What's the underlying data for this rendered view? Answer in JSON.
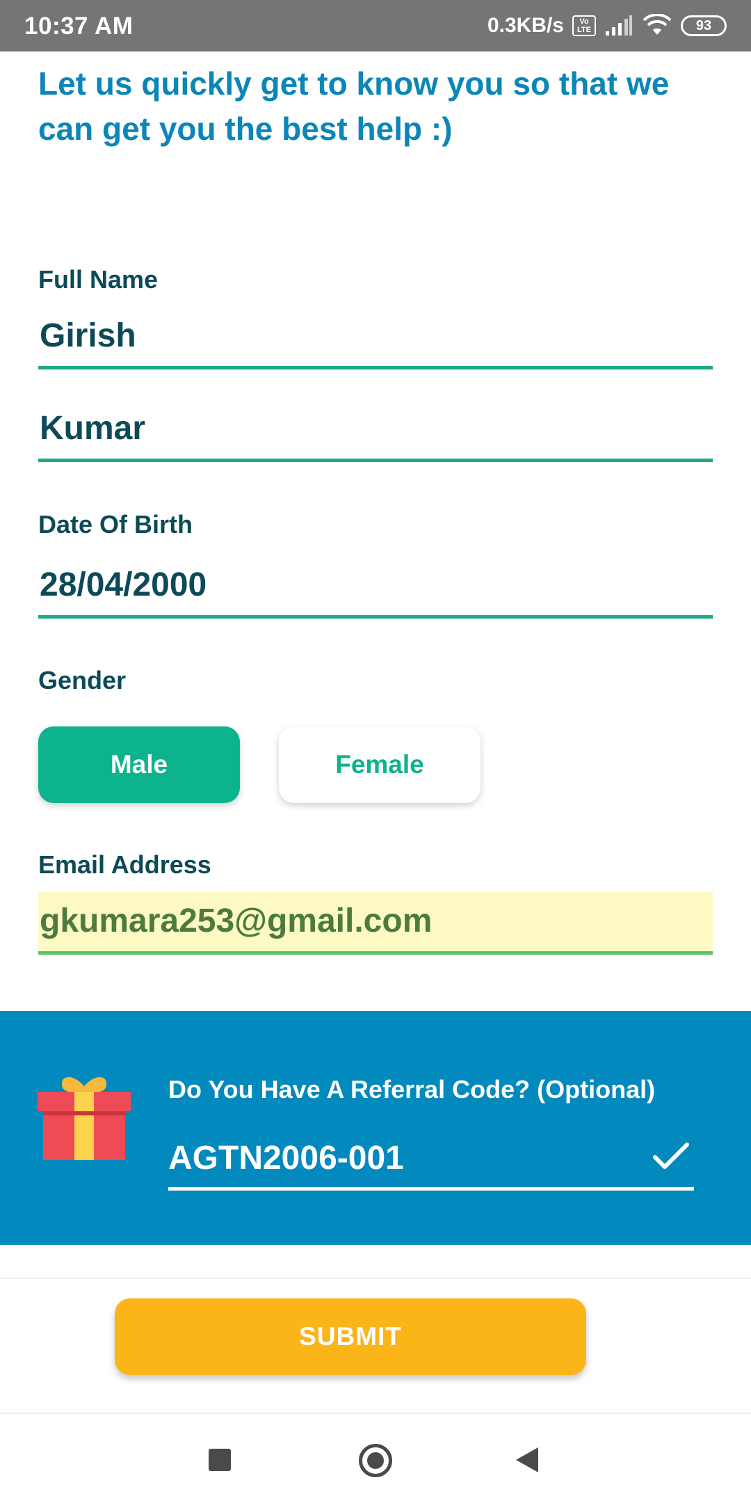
{
  "status_bar": {
    "time": "10:37 AM",
    "net_speed": "0.3KB/s",
    "volte_top": "Vo",
    "volte_bottom": "LTE",
    "battery": "93"
  },
  "intro": {
    "text": "Let us quickly get to know you so that we can get you the best help :)"
  },
  "form": {
    "full_name_label": "Full Name",
    "first_name": "Girish",
    "last_name": "Kumar",
    "dob_label": "Date Of Birth",
    "dob_value": "28/04/2000",
    "gender_label": "Gender",
    "gender_options": [
      "Male",
      "Female"
    ],
    "gender_selected": "Male",
    "email_label": "Email Address",
    "email_value": "gkumara253@gmail.com"
  },
  "referral": {
    "label": "Do You Have A Referral Code? (Optional)",
    "code": "AGTN2006-001"
  },
  "submit": {
    "label": "SUBMIT"
  },
  "colors": {
    "accent_green": "#0db38c",
    "headline_blue": "#0a86b8",
    "referral_bg": "#0289bd",
    "submit_yellow": "#fbb519"
  }
}
